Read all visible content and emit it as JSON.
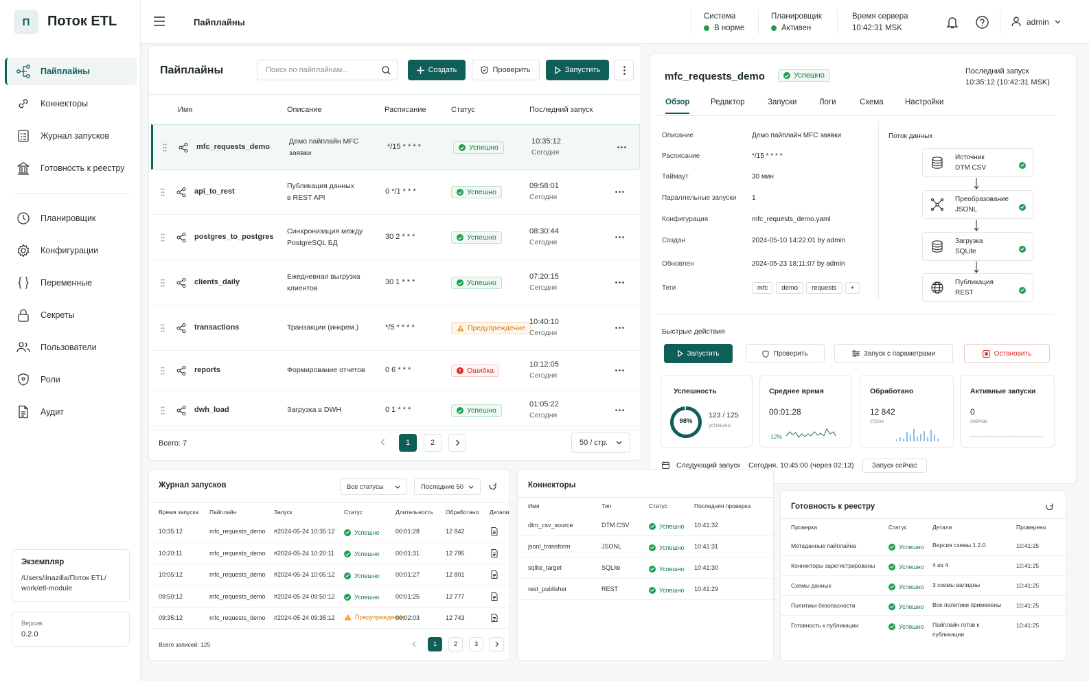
{
  "app": {
    "logo_letter": "П",
    "name": "Поток ETL"
  },
  "sidebar": {
    "items": [
      {
        "label": "Пайплайны",
        "icon": "pipeline-icon",
        "active": true
      },
      {
        "label": "Коннекторы",
        "icon": "link-icon"
      },
      {
        "label": "Журнал запусков",
        "icon": "log-icon"
      },
      {
        "label": "Готовность к реестру",
        "icon": "registry-icon"
      },
      {
        "label": "Планировщик",
        "icon": "clock-icon"
      },
      {
        "label": "Конфигурации",
        "icon": "gear-icon"
      },
      {
        "label": "Переменные",
        "icon": "braces-icon"
      },
      {
        "label": "Секреты",
        "icon": "lock-icon"
      },
      {
        "label": "Пользователи",
        "icon": "users-icon"
      },
      {
        "label": "Роли",
        "icon": "shield-icon"
      },
      {
        "label": "Аудит",
        "icon": "document-icon"
      }
    ],
    "instance": {
      "title": "Экземпляр",
      "path": "/Users/ilnazilla/Поток ETL/\nwork/etl-module"
    },
    "version": {
      "label": "Версия",
      "value": "0.2.0"
    }
  },
  "header": {
    "page_title": "Пайплайны",
    "system": {
      "label": "Система",
      "value": "В норме"
    },
    "scheduler": {
      "label": "Планировщик",
      "value": "Активен"
    },
    "server_time": {
      "label": "Время сервера",
      "value": "10:42:31 MSK"
    },
    "user": "admin"
  },
  "pipelines": {
    "title": "Пайплайны",
    "search_placeholder": "Поиск по пайплайнам...",
    "create_label": "Создать",
    "check_label": "Проверить",
    "run_label": "Запустить",
    "columns": [
      "Имя",
      "Описание",
      "Расписание",
      "Статус",
      "Последний запуск"
    ],
    "rows": [
      {
        "name": "mfc_requests_demo",
        "desc": "Демо пайплайн MFC\nзаявки",
        "schedule": "*/15 * * * *",
        "status": "Успешно",
        "kind": "ok",
        "time": "10:35:12",
        "day": "Сегодня"
      },
      {
        "name": "api_to_rest",
        "desc": "Публикация данных\nв REST API",
        "schedule": "0 */1 * * *",
        "status": "Успешно",
        "kind": "ok",
        "time": "09:58:01",
        "day": "Сегодня"
      },
      {
        "name": "postgres_to_postgres",
        "desc": "Синхронизация между\nPostgreSQL БД",
        "schedule": "30 2 * * *",
        "status": "Успешно",
        "kind": "ok",
        "time": "08:30:44",
        "day": "Сегодня"
      },
      {
        "name": "clients_daily",
        "desc": "Ежедневная выгрузка\nклиентов",
        "schedule": "30 1 * * *",
        "status": "Успешно",
        "kind": "ok",
        "time": "07:20:15",
        "day": "Сегодня"
      },
      {
        "name": "transactions",
        "desc": "Транзакции (инкрем.)",
        "schedule": "*/5 * * * *",
        "status": "Предупреждение",
        "kind": "warn",
        "time": "10:40:10",
        "day": "Сегодня"
      },
      {
        "name": "reports",
        "desc": "Формирование отчетов",
        "schedule": "0 6 * * *",
        "status": "Ошибка",
        "kind": "err",
        "time": "10:12:05",
        "day": "Сегодня"
      },
      {
        "name": "dwh_load",
        "desc": "Загрузка в DWH",
        "schedule": "0 1 * * *",
        "status": "Успешно",
        "kind": "ok",
        "time": "01:05:22",
        "day": "Сегодня"
      }
    ],
    "total": "Всего: 7",
    "pages": [
      "1",
      "2"
    ],
    "per_page": "50 / стр."
  },
  "detail": {
    "name": "mfc_requests_demo",
    "status": "Успешно",
    "last_run_label": "Последний запуск",
    "last_run_value": "10:35:12 (10:42:31 MSK)",
    "tabs": [
      "Обзор",
      "Редактор",
      "Запуски",
      "Логи",
      "Схема",
      "Настройки"
    ],
    "fields": [
      {
        "k": "Описание",
        "v": "Демо пайплайн MFC заявки"
      },
      {
        "k": "Расписание",
        "v": "*/15 * * * *"
      },
      {
        "k": "Таймаут",
        "v": "30 мин"
      },
      {
        "k": "Параллельные запуски",
        "v": "1"
      },
      {
        "k": "Конфигурация",
        "v": "mfc_requests_demo.yaml"
      },
      {
        "k": "Создан",
        "v": "2024-05-10 14:22:01 by admin"
      },
      {
        "k": "Обновлен",
        "v": "2024-05-23 18:11:07 by admin"
      },
      {
        "k": "Теги",
        "v": ""
      }
    ],
    "tags": [
      "mfc",
      "demo",
      "requests"
    ],
    "tag_add": "+",
    "flow_title": "Поток данных",
    "flow": [
      {
        "title": "Источник",
        "sub": "DTM CSV",
        "icon": "database-icon"
      },
      {
        "title": "Преобразование",
        "sub": "JSONL",
        "icon": "transform-icon"
      },
      {
        "title": "Загрузка",
        "sub": "SQLite",
        "icon": "database-icon"
      },
      {
        "title": "Публикация",
        "sub": "REST",
        "icon": "globe-icon"
      }
    ],
    "quick_title": "Быстрые действия",
    "actions": {
      "run": "Запустить",
      "check": "Проверить",
      "params": "Запуск с параметрами",
      "stop": "Остановить"
    },
    "stats": {
      "success": {
        "title": "Успешность",
        "percent": "98%",
        "ratio": "123 / 125",
        "sub": "успешно",
        "fraction": 0.984
      },
      "avg": {
        "title": "Среднее время",
        "value": "00:01:28",
        "delta": "-12%"
      },
      "processed": {
        "title": "Обработано",
        "value": "12 842",
        "sub": "строк"
      },
      "active": {
        "title": "Активные запуски",
        "value": "0",
        "sub": "сейчас"
      }
    },
    "next_run_label": "Следующий запуск",
    "next_run_value": "Сегодня, 10:45:00 (через 02:13)",
    "run_now": "Запуск сейчас"
  },
  "runs": {
    "title": "Журнал запусков",
    "filter_status": "Все статусы",
    "filter_last": "Последние 50",
    "columns": [
      "Время запуска",
      "Пайплайн",
      "Запуск",
      "Статус",
      "Длительность",
      "Обработано",
      "Детали"
    ],
    "rows": [
      {
        "time": "10:35:12",
        "pipe": "mfc_requests_demo",
        "run": "#2024-05-24 10:35:12",
        "status": "Успешно",
        "kind": "ok",
        "dur": "00:01:28",
        "proc": "12 842"
      },
      {
        "time": "10:20:11",
        "pipe": "mfc_requests_demo",
        "run": "#2024-05-24 10:20:11",
        "status": "Успешно",
        "kind": "ok",
        "dur": "00:01:31",
        "proc": "12 795"
      },
      {
        "time": "10:05:12",
        "pipe": "mfc_requests_demo",
        "run": "#2024-05-24 10:05:12",
        "status": "Успешно",
        "kind": "ok",
        "dur": "00:01:27",
        "proc": "12 801"
      },
      {
        "time": "09:50:12",
        "pipe": "mfc_requests_demo",
        "run": "#2024-05-24 09:50:12",
        "status": "Успешно",
        "kind": "ok",
        "dur": "00:01:25",
        "proc": "12 777"
      },
      {
        "time": "09:35:12",
        "pipe": "mfc_requests_demo",
        "run": "#2024-05-24 09:35:12",
        "status": "Предупреждение",
        "kind": "warn",
        "dur": "00:02:03",
        "proc": "12 743"
      }
    ],
    "total": "Всего записей: 125",
    "pages": [
      "1",
      "2",
      "3"
    ]
  },
  "connectors": {
    "title": "Коннекторы",
    "columns": [
      "Имя",
      "Тип",
      "Статус",
      "Последняя проверка"
    ],
    "rows": [
      {
        "name": "dtm_csv_source",
        "type": "DTM CSV",
        "status": "Успешно",
        "time": "10:41:32"
      },
      {
        "name": "jsonl_transform",
        "type": "JSONL",
        "status": "Успешно",
        "time": "10:41:31"
      },
      {
        "name": "sqlite_target",
        "type": "SQLite",
        "status": "Успешно",
        "time": "10:41:30"
      },
      {
        "name": "rest_publisher",
        "type": "REST",
        "status": "Успешно",
        "time": "10:41:29"
      }
    ]
  },
  "registry": {
    "title": "Готовность к реестру",
    "columns": [
      "Проверка",
      "Статус",
      "Детали",
      "Проверено"
    ],
    "rows": [
      {
        "check": "Метаданные пайплайна",
        "status": "Успешно",
        "details": "Версия схемы 1.2.0",
        "time": "10:41:25"
      },
      {
        "check": "Коннекторы зарегистрированы",
        "status": "Успешно",
        "details": "4 из 4",
        "time": "10:41:25"
      },
      {
        "check": "Схемы данных",
        "status": "Успешно",
        "details": "3 схемы валидны",
        "time": "10:41:25"
      },
      {
        "check": "Политики безопасности",
        "status": "Успешно",
        "details": "Все политики применены",
        "time": "10:41:25"
      },
      {
        "check": "Готовность к публикации",
        "status": "Успешно",
        "details": "Пайплайн готов к\nпубликации",
        "time": "10:41:25"
      }
    ]
  },
  "colors": {
    "primary": "#0f5e57",
    "success": "#1f9d55",
    "warning": "#f29a1f",
    "error": "#d62b2b",
    "chart": "#4a90d9"
  }
}
